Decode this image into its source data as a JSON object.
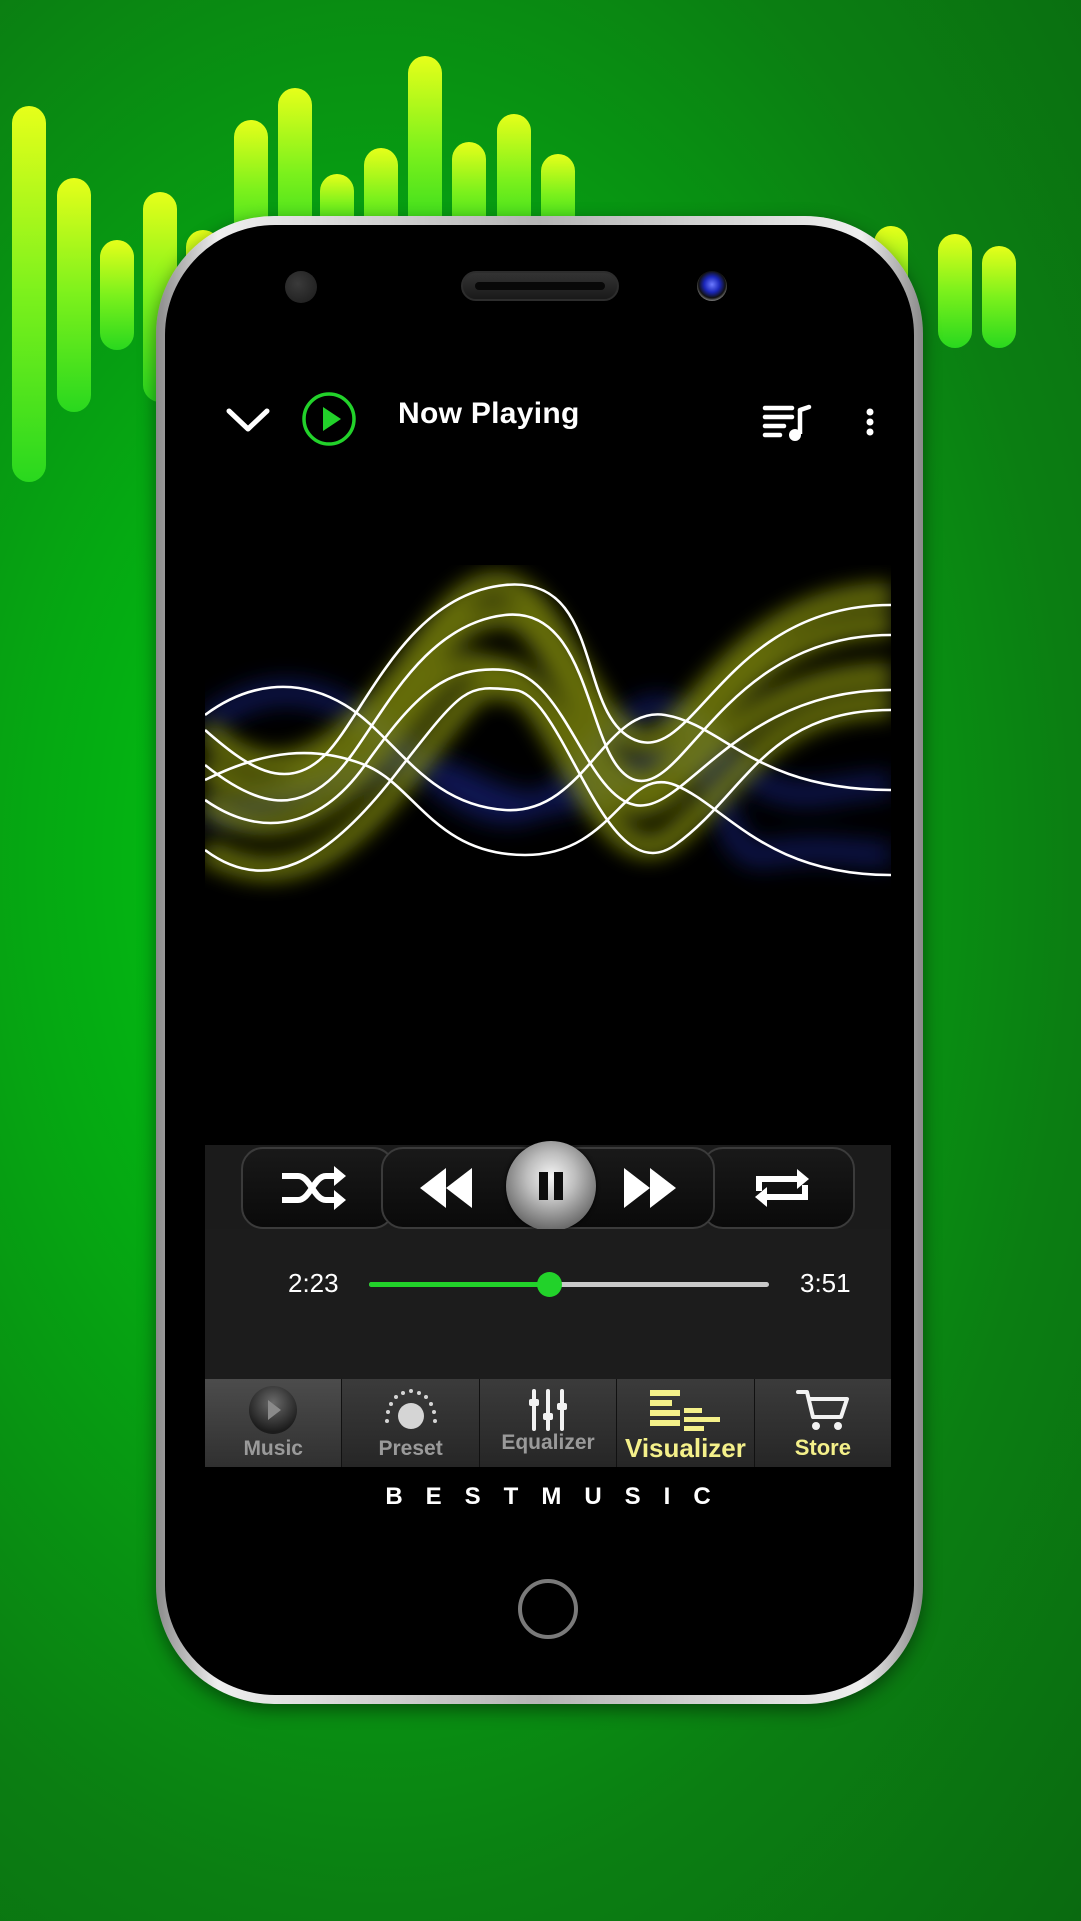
{
  "header": {
    "title": "Now Playing",
    "collapse_icon": "chevron-down-icon",
    "play_icon": "play-circle-icon",
    "queue_icon": "queue-music-icon",
    "more_icon": "more-vertical-icon"
  },
  "player": {
    "current_time": "2:23",
    "total_time": "3:51",
    "progress": 0.45,
    "controls": [
      "shuffle-icon",
      "rewind-icon",
      "pause-icon",
      "fast-forward-icon",
      "repeat-icon"
    ]
  },
  "tabs": [
    {
      "id": "music",
      "label": "Music",
      "icon": "play-disc-icon"
    },
    {
      "id": "preset",
      "label": "Preset",
      "icon": "preset-dial-icon"
    },
    {
      "id": "equalizer",
      "label": "Equalizer",
      "icon": "equalizer-sliders-icon"
    },
    {
      "id": "visualizer",
      "label": "Visualizer",
      "icon": "visualizer-bars-icon"
    },
    {
      "id": "store",
      "label": "Store",
      "icon": "shopping-cart-icon"
    }
  ],
  "brand": "BESTMUSIC",
  "colors": {
    "accent_green": "#22d22a",
    "active_tab_text": "#f4f08a",
    "bg_green": "#05a812"
  }
}
